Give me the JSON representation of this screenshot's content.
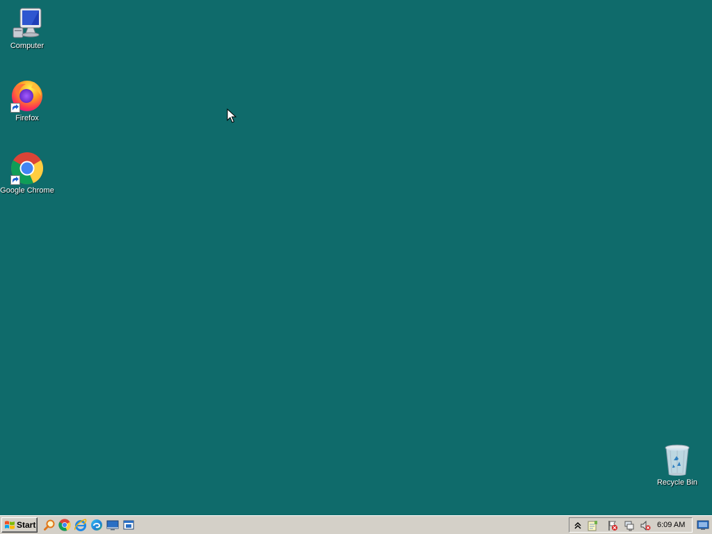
{
  "desktop": {
    "background_color": "#0f6b6b",
    "icons": [
      {
        "label": "Computer",
        "icon": "computer-icon"
      },
      {
        "label": "Firefox",
        "icon": "firefox-icon",
        "shortcut": true
      },
      {
        "label": "Google Chrome",
        "icon": "chrome-icon",
        "shortcut": true
      },
      {
        "label": "Recycle Bin",
        "icon": "recycle-bin-icon"
      }
    ]
  },
  "taskbar": {
    "start_label": "Start",
    "quick_launch": [
      "search-icon",
      "chrome-icon",
      "internet-explorer-icon",
      "edge-icon",
      "desktop-icon",
      "window-switcher-icon"
    ],
    "tray": {
      "icons": [
        "show-hidden-icons-chevron",
        "notes-icon",
        "action-center-flag-icon",
        "network-icon",
        "volume-muted-icon"
      ],
      "clock": "6:09 AM"
    }
  }
}
